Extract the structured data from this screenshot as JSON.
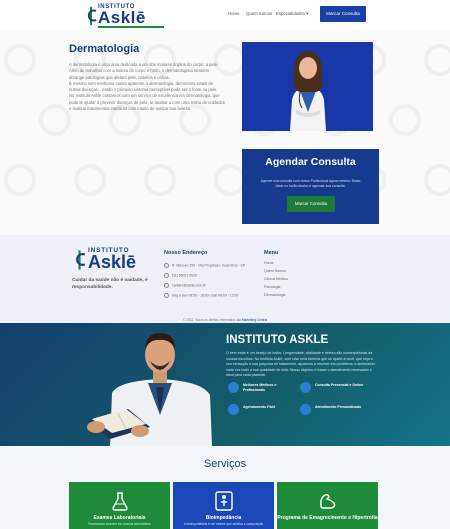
{
  "header": {
    "logo_small": "INSTITUTO",
    "logo_big": "Asklē",
    "nav": [
      "Home",
      "Quem Somos",
      "Especialidades"
    ],
    "cta": "Marcar Consulta"
  },
  "hero": {
    "title": "Dermatologia",
    "paragraphs": [
      "A dermatologia é uma área dedicada a um dos maiores órgãos do corpo: a pele.",
      "Além de trabalhar com a beleza do corpo e rosto, o dermatologista também abrange patologias que afetam pele, cabelos e unhas.",
      "É mesmo sem nenhuma causa aparente a dermatologia, demonstra sinais de outras doenças... então o primeiro sintoma perceptível pode ser a fonte na pele.",
      "No Instituto Asklē contamos com um serviço de excelência em dermatologia, que pode te ajudar a prevenir doenças de pele, te auxiliar a com uma rotina de cuidados e realizar tratamentos estéticos com intuito de realçar sua beleza."
    ]
  },
  "agenda": {
    "title": "Agendar Consulta",
    "text": "Agende sua consulta com nosso Profissional agora mesmo. Basta clicar no botão abaixo e agendar sua consulta.",
    "button": "Marcar Consulta"
  },
  "footer": {
    "logo_small": "INSTITUTO",
    "logo_big": "Asklē",
    "tagline": "Cuidar da saúde não é vaidade, é responsabilidade.",
    "address_title": "Nosso Endereço",
    "address": [
      "R. Manoel, 255 - Vila Progresso, Guarulhos - SP",
      "(11) 96021-9020",
      "contato@askle.com.br",
      "Seg a Sex 08:00 - 18:00 | Sab 08:00 - 12:00"
    ],
    "menu_title": "Menu",
    "menu": [
      "Home",
      "Quem Somos",
      "Clínica Médica",
      "Psicologia",
      "Dermatologia"
    ],
    "copyright_prefix": "© 2022. Todos os direitos reservados.",
    "copyright_link": "Ao Marketing Central"
  },
  "banner": {
    "title": "INSTITUTO ASKLE",
    "text": "O bem estar é um desejo de todos. Longevidade, vitalidade e beleza são consequências da nossas escolhas. No Instituto Asklē, vem criar uma fórmula que se ajuste a você, que seja a sua sensação e sua proposta de tratamento, ajudando a resolver seu problema, e acelerando cada vez mais a sua qualidade de vida. Nosso objetivo é trazer o atendimento necessário e ideal para cada paciente.",
    "features": [
      "Melhores Médicos e Profissionais",
      "Consulta Presencial e Online",
      "Agendamento Fácil",
      "Atendimento Personalizado"
    ]
  },
  "services": {
    "title": "Serviços",
    "cards": [
      {
        "title": "Exames Laboratoriais",
        "sub": "Realizamos exames em nossos laboratórios"
      },
      {
        "title": "Bioimpedância",
        "sub": "A bioimpedância é um exame que analisa a composição"
      },
      {
        "title": "Programa de Emagrecimento e Hipertrofia",
        "sub": ""
      }
    ]
  },
  "colors": {
    "primary_blue": "#1a3fa6",
    "dark_blue": "#1d3c7a",
    "green": "#1f8a3a"
  }
}
